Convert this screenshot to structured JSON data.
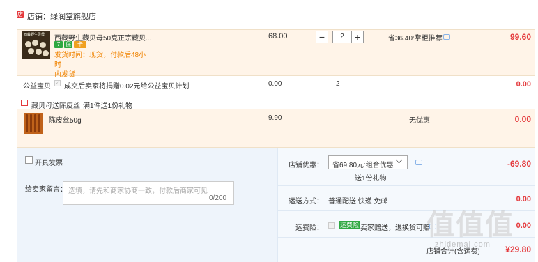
{
  "store": {
    "label": "店铺：绿润堂旗舰店",
    "icon": "store-icon"
  },
  "item": {
    "thumb_text": "西藏野生贝母",
    "title": "西藏野生藏贝母50克正宗藏贝...",
    "badges": [
      {
        "text": "7",
        "color": "#2fa842",
        "icon": "seven-day-return-icon"
      },
      {
        "text": "保",
        "color": "#2fa842",
        "icon": "guarantee-icon"
      },
      {
        "text": "卡",
        "color": "#f0a020",
        "icon": "card-icon"
      }
    ],
    "delivery_line1": "发货时间：现货，付款后48小时",
    "delivery_line2": "内发货",
    "price": "68.00",
    "qty_minus": "−",
    "qty_value": "2",
    "qty_plus": "+",
    "savings": "省36.40:掌柜推荐",
    "subtotal": "99.60"
  },
  "charity": {
    "label": "公益宝贝",
    "check": "✓",
    "text": "成交后卖家将捐赠0.02元给公益宝贝计划",
    "price": "0.00",
    "qty": "2",
    "total": "0.00"
  },
  "gift": {
    "label": "藏贝母送陈皮丝",
    "promo": "满1件送1份礼物",
    "name": "陈皮丝50g",
    "price": "9.90",
    "discount": "无优惠",
    "total": "0.00"
  },
  "invoice": {
    "label": "开具发票"
  },
  "message": {
    "label": "给卖家留言：",
    "placeholder": "选填，请先和商家协商一致，付款后商家可见",
    "count": "0/200"
  },
  "store_discount": {
    "label": "店铺优惠：",
    "selected": "省69.80元:组合优惠",
    "gift_note": "送1份礼物",
    "total": "-69.80"
  },
  "shipping": {
    "label": "运送方式：",
    "value": "普通配送 快递 免邮",
    "total": "0.00"
  },
  "insurance": {
    "label": "运费险：",
    "check": "✓",
    "badge": "运费险",
    "text": "卖家赠送，退换货可赔",
    "total": "0.00"
  },
  "grand": {
    "label": "店铺合计(含运费)",
    "total": "¥29.80"
  },
  "watermark": {
    "text": "值值值",
    "sub": "zhidemai.com"
  }
}
